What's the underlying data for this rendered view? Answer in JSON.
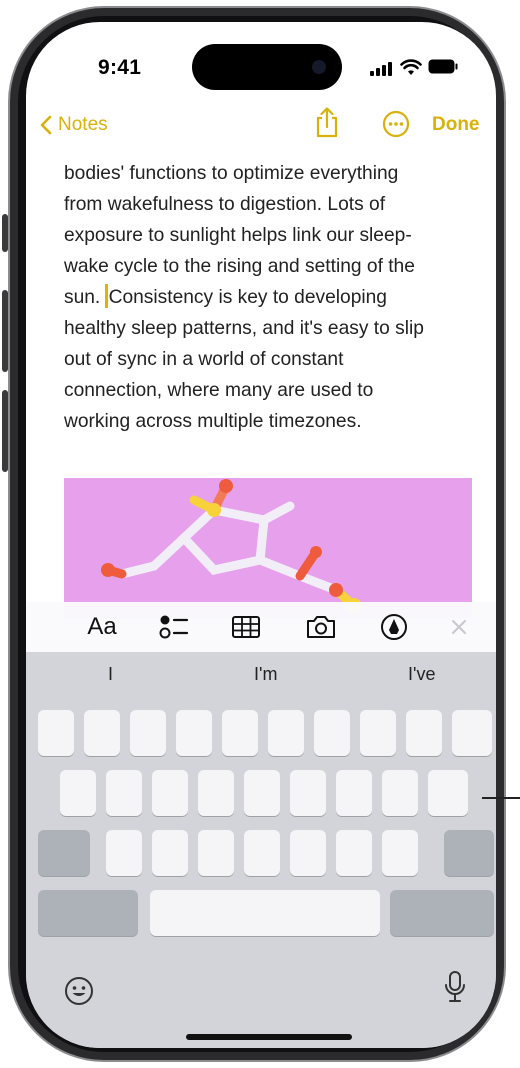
{
  "status_bar": {
    "time": "9:41"
  },
  "nav": {
    "back_label": "Notes",
    "done_label": "Done"
  },
  "note": {
    "lines": [
      "bodies' functions to optimize everything",
      "from wakefulness to digestion. Lots of",
      "exposure to sunlight helps link our sleep-",
      "wake cycle to the rising and setting of the"
    ],
    "line5_before_caret": "sun. ",
    "line5_after_caret": "Consistency is key to developing",
    "lines_after": [
      "healthy sleep patterns, and it's easy to slip",
      "out of sync in a world of constant",
      "connection, where many are used to",
      "working across multiple timezones."
    ]
  },
  "toolbar": {
    "format_label": "Aa"
  },
  "keyboard": {
    "suggestions": [
      "I",
      "I'm",
      "I've"
    ]
  },
  "colors": {
    "accent": "#d8b10b",
    "image_bg": "#e6a0ec",
    "keyboard_bg": "#d2d4d9"
  },
  "icons": [
    "back-chevron-icon",
    "share-icon",
    "more-icon",
    "checklist-icon",
    "table-icon",
    "camera-icon",
    "markup-icon",
    "close-icon",
    "emoji-icon",
    "microphone-icon"
  ]
}
